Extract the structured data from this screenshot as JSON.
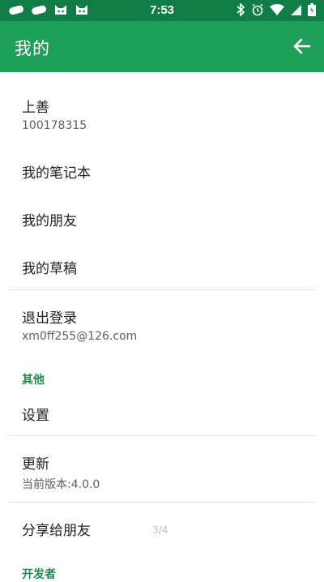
{
  "status": {
    "time": "7:53"
  },
  "header": {
    "title": "我的"
  },
  "account": {
    "name": "上善",
    "id": "100178315"
  },
  "menu": {
    "notebooks": "我的笔记本",
    "friends": "我的朋友",
    "drafts": "我的草稿"
  },
  "logout": {
    "label": "退出登录",
    "email": "xm0ff255@126.com"
  },
  "sections": {
    "other": "其他",
    "developer": "开发者"
  },
  "other": {
    "settings": "设置",
    "update_label": "更新",
    "update_version": "当前版本:4.0.0",
    "share": "分享给朋友"
  },
  "overlay": {
    "page_indicator": "3/4"
  },
  "colors": {
    "statusbar": "#0f7d45",
    "appbar": "#1fa05a",
    "section_text": "#1d8a4f"
  }
}
